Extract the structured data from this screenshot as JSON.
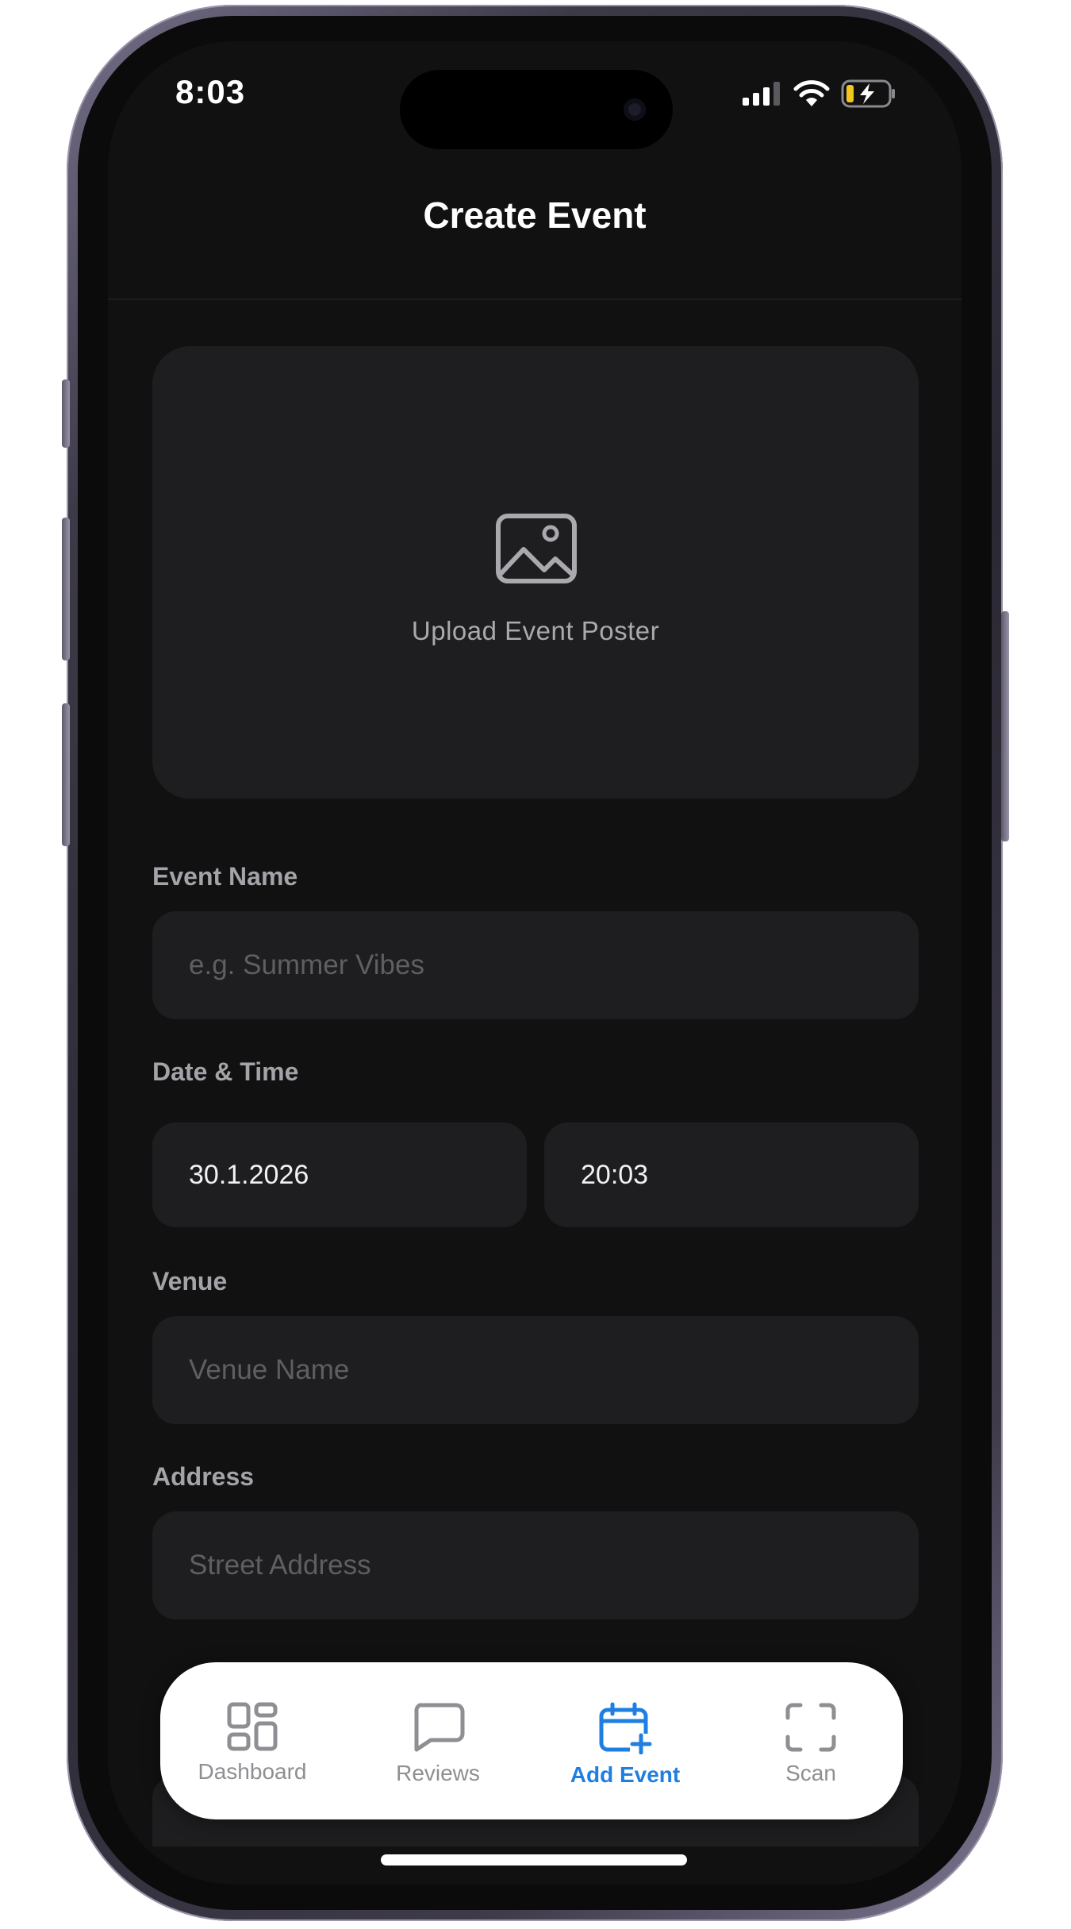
{
  "status_bar": {
    "time": "8:03"
  },
  "header": {
    "title": "Create Event"
  },
  "upload": {
    "label": "Upload Event Poster",
    "icon": "image-icon"
  },
  "form": {
    "event_name": {
      "label": "Event Name",
      "placeholder": "e.g. Summer Vibes"
    },
    "date_time": {
      "label": "Date & Time",
      "date_value": "30.1.2026",
      "time_value": "20:03"
    },
    "venue": {
      "label": "Venue",
      "placeholder": "Venue Name"
    },
    "address": {
      "label": "Address",
      "placeholder": "Street Address"
    }
  },
  "tabbar": {
    "items": [
      {
        "label": "Dashboard",
        "icon": "grid-icon",
        "active": false
      },
      {
        "label": "Reviews",
        "icon": "chat-bubble-icon",
        "active": false
      },
      {
        "label": "Add Event",
        "icon": "calendar-plus-icon",
        "active": true
      },
      {
        "label": "Scan",
        "icon": "scan-frame-icon",
        "active": false
      }
    ]
  },
  "colors": {
    "background": "#111112",
    "field": "#1e1e20",
    "accent": "#1f7fe0",
    "tab_inactive": "#8e8e93"
  }
}
